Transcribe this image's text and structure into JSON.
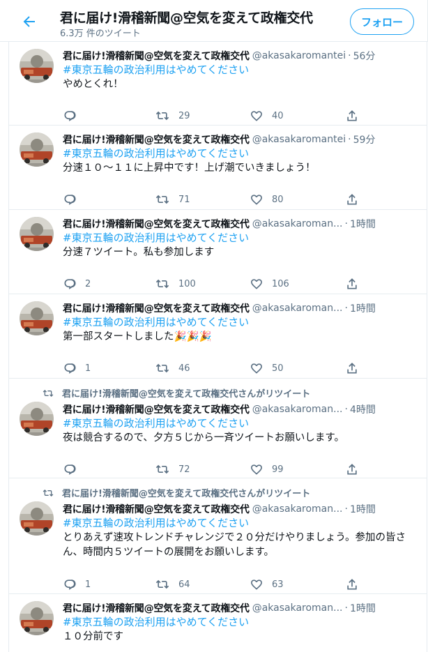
{
  "header": {
    "title": "君に届け!滑稽新聞@空気を変えて政権交代",
    "tweet_count": "6.3万 件のツイート",
    "follow_label": "フォロー"
  },
  "tweets": [
    {
      "retweet_label": "",
      "name": "君に届け!滑稽新聞@空気を変えて政権交代",
      "handle": "@akasakaromantei",
      "time": "56分",
      "hashtag": "#東京五輪の政治利用はやめてください",
      "text": "やめとくれ！",
      "replies": "",
      "retweets": "29",
      "likes": "40"
    },
    {
      "retweet_label": "",
      "name": "君に届け!滑稽新聞@空気を変えて政権交代",
      "handle": "@akasakaromantei",
      "time": "59分",
      "hashtag": "#東京五輪の政治利用はやめてください",
      "text": "分速１０～１１に上昇中です！上げ潮でいきましょう！",
      "replies": "",
      "retweets": "71",
      "likes": "80"
    },
    {
      "retweet_label": "",
      "name": "君に届け!滑稽新聞@空気を変えて政権交代",
      "handle": "@akasakaroman...",
      "time": "1時間",
      "hashtag": "#東京五輪の政治利用はやめてください",
      "text": "分速７ツイート。私も参加します",
      "replies": "2",
      "retweets": "100",
      "likes": "106"
    },
    {
      "retweet_label": "",
      "name": "君に届け!滑稽新聞@空気を変えて政権交代",
      "handle": "@akasakaroman...",
      "time": "1時間",
      "hashtag": "#東京五輪の政治利用はやめてください",
      "text": "第一部スタートしました🎉🎉🎉",
      "replies": "1",
      "retweets": "46",
      "likes": "50"
    },
    {
      "retweet_label": "君に届け!滑稽新聞@空気を変えて政権交代さんがリツイート",
      "name": "君に届け!滑稽新聞@空気を変えて政権交代",
      "handle": "@akasakaroman...",
      "time": "4時間",
      "hashtag": "#東京五輪の政治利用はやめてください",
      "text": "夜は競合するので、夕方５じから一斉ツイートお願いします。",
      "replies": "",
      "retweets": "72",
      "likes": "99"
    },
    {
      "retweet_label": "君に届け!滑稽新聞@空気を変えて政権交代さんがリツイート",
      "name": "君に届け!滑稽新聞@空気を変えて政権交代",
      "handle": "@akasakaroman...",
      "time": "1時間",
      "hashtag": "#東京五輪の政治利用はやめてください",
      "text": "とりあえず速攻トレンドチャレンジで２０分だけやりましょう。参加の皆さん、時間内５ツイートの展開をお願いします。",
      "replies": "1",
      "retweets": "64",
      "likes": "63"
    },
    {
      "retweet_label": "",
      "name": "君に届け!滑稽新聞@空気を変えて政権交代",
      "handle": "@akasakaroman...",
      "time": "1時間",
      "hashtag": "#東京五輪の政治利用はやめてください",
      "text": "１０分前です",
      "replies": "",
      "retweets": "",
      "likes": ""
    }
  ],
  "icons": [
    "back-arrow-icon",
    "reply-icon",
    "retweet-icon",
    "like-icon",
    "share-icon"
  ],
  "colors": {
    "accent": "#1da1f2",
    "secondary_text": "#5b7083",
    "border": "#e6ecf0"
  }
}
